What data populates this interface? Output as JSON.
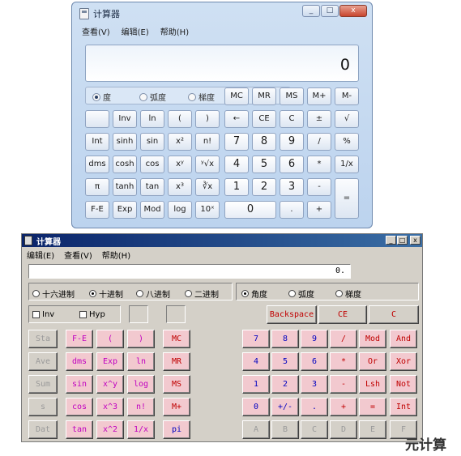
{
  "win7": {
    "title": "计算器",
    "controls": [
      "_",
      "□",
      "x"
    ],
    "menu": [
      "查看(V)",
      "编辑(E)",
      "帮助(H)"
    ],
    "display": "0",
    "angle_modes": [
      {
        "label": "度",
        "selected": true
      },
      {
        "label": "弧度",
        "selected": false
      },
      {
        "label": "梯度",
        "selected": false
      }
    ],
    "memory_buttons": [
      "MC",
      "MR",
      "MS",
      "M+",
      "M-"
    ],
    "rows": [
      [
        "",
        "Inv",
        "ln",
        "(",
        ")",
        "←",
        "CE",
        "C",
        "±",
        "√"
      ],
      [
        "Int",
        "sinh",
        "sin",
        "x²",
        "n!",
        "7",
        "8",
        "9",
        "/",
        "%"
      ],
      [
        "dms",
        "cosh",
        "cos",
        "xʸ",
        "ʸ√x",
        "4",
        "5",
        "6",
        "*",
        "1/x"
      ],
      [
        "π",
        "tanh",
        "tan",
        "x³",
        "∛x",
        "1",
        "2",
        "3",
        "-"
      ],
      [
        "F-E",
        "Exp",
        "Mod",
        "log",
        "10ˣ",
        "0",
        ".",
        "+"
      ]
    ],
    "equals": "="
  },
  "classic": {
    "title": "计算器",
    "controls": [
      "_",
      "□",
      "x"
    ],
    "menu": [
      "编辑(E)",
      "查看(V)",
      "帮助(H)"
    ],
    "display": "0.",
    "bases": [
      {
        "label": "十六进制",
        "selected": false
      },
      {
        "label": "十进制",
        "selected": true
      },
      {
        "label": "八进制",
        "selected": false
      },
      {
        "label": "二进制",
        "selected": false
      }
    ],
    "angles": [
      {
        "label": "角度",
        "selected": true
      },
      {
        "label": "弧度",
        "selected": false
      },
      {
        "label": "梯度",
        "selected": false
      }
    ],
    "checks": [
      "Inv",
      "Hyp"
    ],
    "edit_buttons": [
      "Backspace",
      "CE",
      "C"
    ],
    "sci_rows": [
      [
        "Sta",
        "F-E",
        "(",
        ")"
      ],
      [
        "Ave",
        "dms",
        "Exp",
        "ln"
      ],
      [
        "Sum",
        "sin",
        "x^y",
        "log"
      ],
      [
        "s",
        "cos",
        "x^3",
        "n!"
      ],
      [
        "Dat",
        "tan",
        "x^2",
        "1/x"
      ]
    ],
    "mem_buttons": [
      "MC",
      "MR",
      "MS",
      "M+",
      "pi"
    ],
    "num_rows": [
      [
        "7",
        "8",
        "9",
        "/",
        "Mod",
        "And"
      ],
      [
        "4",
        "5",
        "6",
        "*",
        "Or",
        "Xor"
      ],
      [
        "1",
        "2",
        "3",
        "-",
        "Lsh",
        "Not"
      ],
      [
        "0",
        "+/-",
        ".",
        "+",
        "=",
        "Int"
      ],
      [
        "A",
        "B",
        "C",
        "D",
        "E",
        "F"
      ]
    ]
  },
  "watermark": "元计算"
}
